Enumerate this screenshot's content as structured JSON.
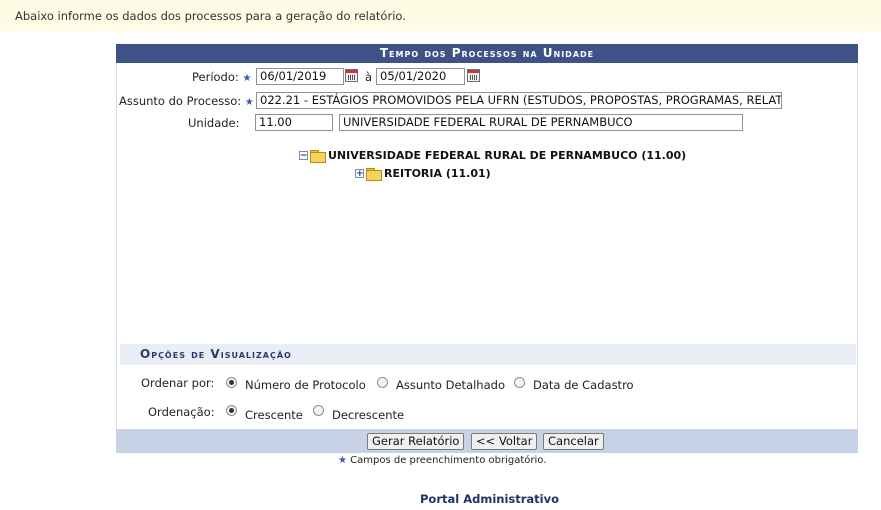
{
  "info_message": "Abaixo informe os dados dos processos para a geração do relatório.",
  "panel": {
    "title": "Tempo dos Processos na Unidade"
  },
  "form": {
    "periodo_label": "Período:",
    "periodo_inicio": "06/01/2019",
    "periodo_separador": "à",
    "periodo_fim": "05/01/2020",
    "assunto_label": "Assunto do Processo:",
    "assunto_value": "022.21 - ESTÁGIOS PROMOVIDOS PELA UFRN (ESTUDOS, PROPOSTAS, PROGRAMAS, RELAT",
    "unidade_label": "Unidade:",
    "unidade_codigo": "11.00",
    "unidade_nome": "UNIVERSIDADE FEDERAL RURAL DE PERNAMBUCO"
  },
  "tree": {
    "root": {
      "toggle": "−",
      "label": "UNIVERSIDADE FEDERAL RURAL DE PERNAMBUCO (11.00)"
    },
    "child": {
      "toggle": "+",
      "label": "REITORIA (11.01)"
    }
  },
  "options": {
    "header": "Opções de Visualização",
    "ordenar_label": "Ordenar por:",
    "ordenar_items": [
      "Número de Protocolo",
      "Assunto Detalhado",
      "Data de Cadastro"
    ],
    "ordenar_selected": "Número de Protocolo",
    "ordenacao_label": "Ordenação:",
    "ordenacao_items": [
      "Crescente",
      "Decrescente"
    ],
    "ordenacao_selected": "Crescente"
  },
  "buttons": {
    "gerar": "Gerar Relatório",
    "voltar": "<< Voltar",
    "cancelar": "Cancelar"
  },
  "required_note": "Campos de preenchimento obrigatório.",
  "required_marker": "★",
  "portal_link": "Portal Administrativo",
  "colors": {
    "title_bar": "#3e5287",
    "info_bar": "#fdfde6",
    "footer_bar": "#c8d2e6",
    "options_header": "#e9edf4"
  }
}
